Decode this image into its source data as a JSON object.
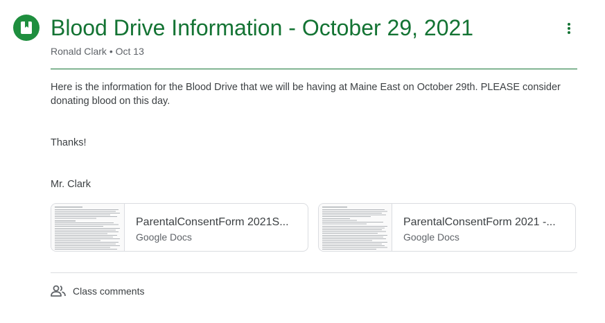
{
  "post": {
    "icon": "assignment-bookmark-icon",
    "title": "Blood Drive Information - October 29, 2021",
    "author": "Ronald Clark",
    "separator": "•",
    "date": "Oct 13",
    "more_icon": "more-vert-icon",
    "body": {
      "paragraph_1": "Here is the information for the Blood Drive that we will be having at Maine East on October 29th.  PLEASE consider donating blood on this day.",
      "paragraph_2": "Thanks!",
      "paragraph_3": "Mr. Clark"
    }
  },
  "attachments": [
    {
      "name": "ParentalConsentForm 2021S...",
      "type": "Google Docs"
    },
    {
      "name": "ParentalConsentForm 2021 -...",
      "type": "Google Docs"
    }
  ],
  "comments": {
    "icon": "people-icon",
    "label": "Class comments"
  },
  "colors": {
    "accent": "#137333",
    "icon_bg": "#1e8e3e",
    "text": "#3c4043",
    "muted": "#5f6368",
    "border": "#dadce0"
  }
}
